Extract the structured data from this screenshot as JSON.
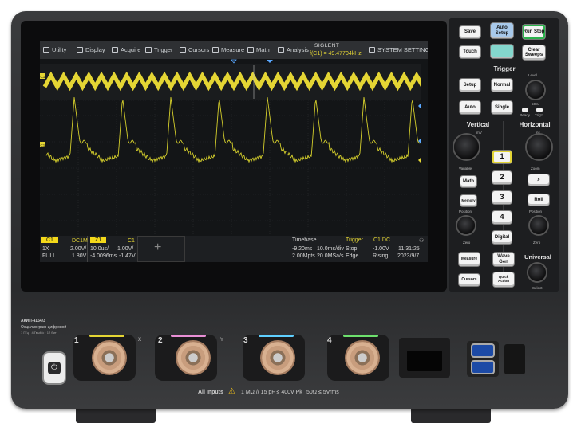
{
  "menu": {
    "utility": "Utility",
    "display": "Display",
    "acquire": "Acquire",
    "trigger": "Trigger",
    "cursors": "Cursors",
    "measure": "Measure",
    "math": "Math",
    "analysis": "Analysis",
    "brand": "SIGLENT",
    "system_settings": "SYSTEM SETTINGS",
    "frequency": "f(C1) = 49.47704kHz"
  },
  "markers": {
    "zoom_channel": "C1",
    "main_channel": "C1"
  },
  "info": {
    "c1": {
      "tag": "C1",
      "coupling": "DC1M",
      "probe": "1X",
      "scale": "2.00V/",
      "bw": "FULL",
      "offset": "1.80V"
    },
    "z1": {
      "tag": "Z1",
      "src": "C1",
      "time": "10.0us/",
      "volts": "1.00V/",
      "pos": "-4.0096ms",
      "offset": "-1.47V"
    },
    "timebase": {
      "label": "Timebase",
      "delay": "-9.20ms",
      "per_div": "10.0ms/div",
      "points": "2.00Mpts",
      "rate": "20.0MSa/s"
    },
    "trigger": {
      "label": "Trigger",
      "src": "C1 DC",
      "mode": "Stop",
      "level": "-1.00V",
      "type": "Edge",
      "slope": "Rising"
    },
    "clock": {
      "time": "11:31:25",
      "date": "2023/9/7"
    }
  },
  "panel": {
    "save": "Save",
    "auto_setup": "Auto Setup",
    "run_stop": "Run Stop",
    "touch": "Touch",
    "clear_sweeps": "Clear Sweeps",
    "trigger_title": "Trigger",
    "setup": "Setup",
    "normal": "Normal",
    "auto": "Auto",
    "single": "Single",
    "level": "Level",
    "ready": "Ready",
    "trigd": "Trig'd",
    "fifty": "50%",
    "vertical": "Vertical",
    "horizontal": "Horizontal",
    "variable": "Variable",
    "zoom": "Zoom",
    "math": "Math",
    "memory": "Memory",
    "position_v": "Position",
    "position_h": "Position",
    "zero_v": "Zero",
    "zero_h": "Zero",
    "ch1": "1",
    "ch2": "2",
    "ch3": "3",
    "ch4": "4",
    "roll": "Roll",
    "digital": "Digital",
    "measure": "Measure",
    "wave_gen": "Wave Gen",
    "universal": "Universal",
    "cursors": "Cursors",
    "quick_action": "Quick Action",
    "select": "Select",
    "mv": "mV",
    "ns": "ns"
  },
  "front": {
    "model": "АКИП-4154/3",
    "desc": "Осциллограф цифровой",
    "specs": "1 ГГц · 4 Гвыб/с · 12 бит",
    "ch1": "1",
    "ch2": "2",
    "ch3": "3",
    "ch4": "4",
    "x": "X",
    "y": "Y",
    "all_inputs": "All Inputs",
    "spec_line": "1 MΩ // 15 pF ≤ 400V Pk",
    "spec_line2": "50Ω ≤ 5Vrms"
  },
  "colors": {
    "ch1": "#e4d534",
    "zoom_bg": "#f3d81a",
    "panel_blue": "#a8c9ea",
    "panel_teal": "#84d7cd"
  }
}
